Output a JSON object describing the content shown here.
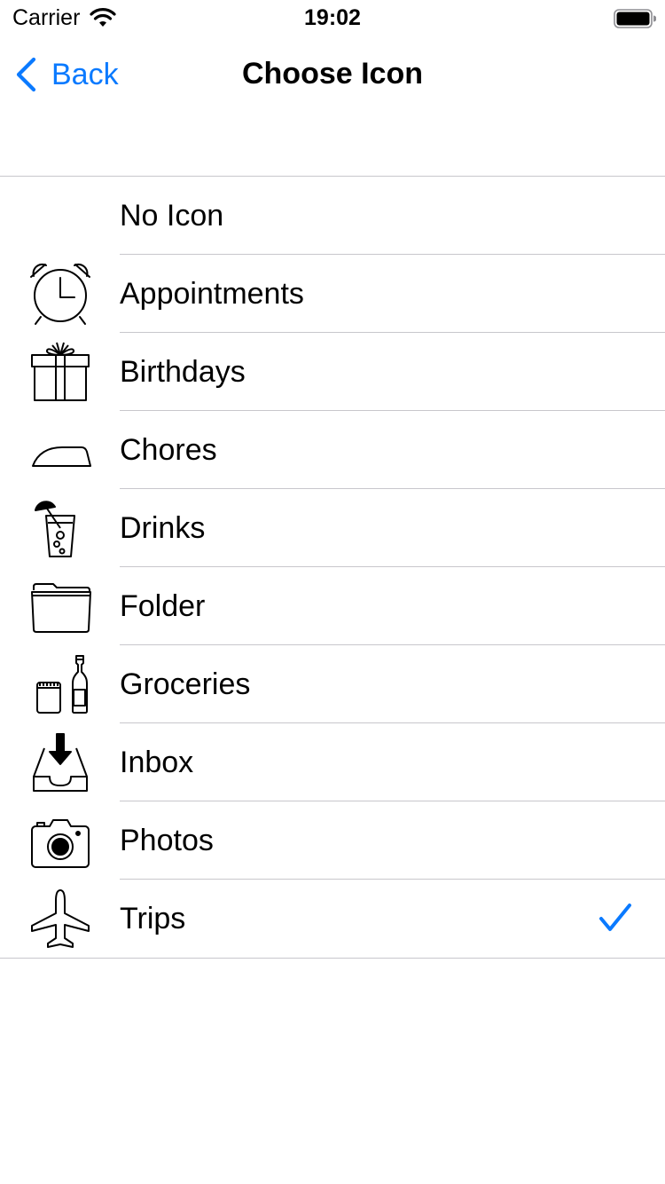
{
  "status_bar": {
    "carrier": "Carrier",
    "time": "19:02",
    "icons": [
      "wifi-icon",
      "battery-icon"
    ]
  },
  "nav": {
    "back_label": "Back",
    "title": "Choose Icon"
  },
  "colors": {
    "accent": "#0a7aff",
    "separator": "#c8c7cc"
  },
  "items": [
    {
      "label": "No Icon",
      "icon": "none",
      "selected": false
    },
    {
      "label": "Appointments",
      "icon": "alarm-clock-icon",
      "selected": false
    },
    {
      "label": "Birthdays",
      "icon": "gift-icon",
      "selected": false
    },
    {
      "label": "Chores",
      "icon": "iron-icon",
      "selected": false
    },
    {
      "label": "Drinks",
      "icon": "drink-icon",
      "selected": false
    },
    {
      "label": "Folder",
      "icon": "folder-icon",
      "selected": false
    },
    {
      "label": "Groceries",
      "icon": "groceries-icon",
      "selected": false
    },
    {
      "label": "Inbox",
      "icon": "inbox-icon",
      "selected": false
    },
    {
      "label": "Photos",
      "icon": "camera-icon",
      "selected": false
    },
    {
      "label": "Trips",
      "icon": "airplane-icon",
      "selected": true
    }
  ]
}
